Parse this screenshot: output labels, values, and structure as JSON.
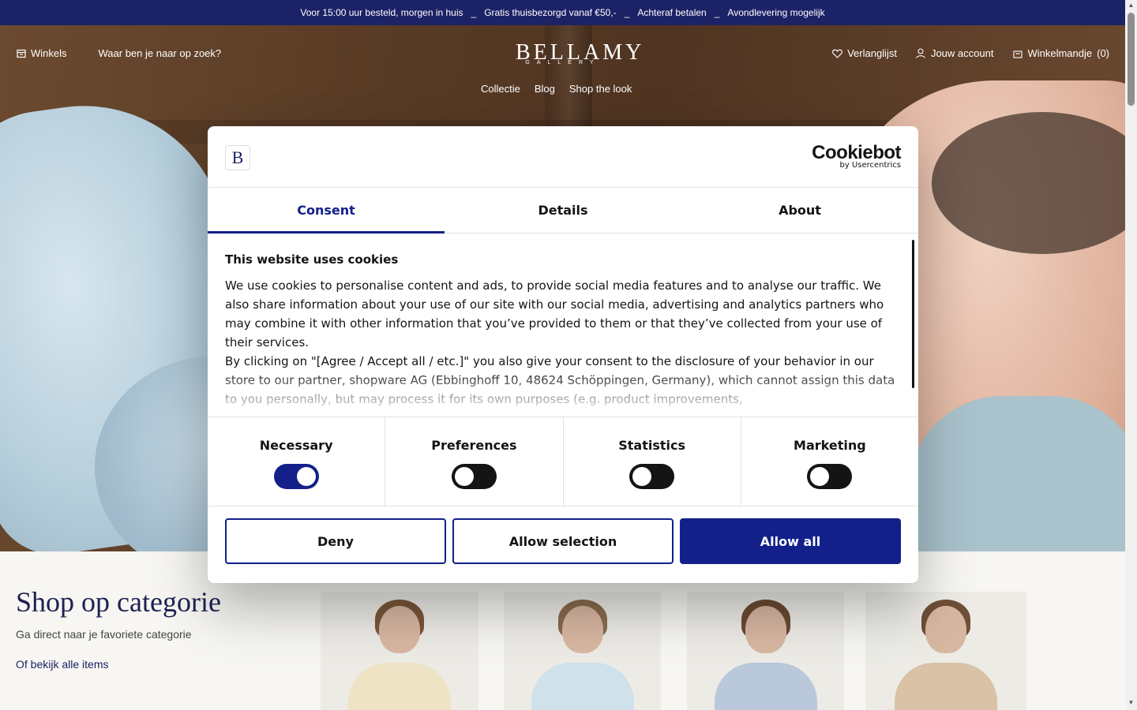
{
  "promo_bar": {
    "items": [
      "Voor 15:00 uur besteld, morgen in huis",
      "Gratis thuisbezorgd vanaf €50,-",
      "Achteraf betalen",
      "Avondlevering mogelijk"
    ],
    "separator": "_"
  },
  "header": {
    "stores_label": "Winkels",
    "search_placeholder": "Waar ben je naar op zoek?",
    "logo_text": "BELLAMY",
    "logo_subtext": "GALLERY",
    "wishlist_label": "Verlanglijst",
    "account_label": "Jouw account",
    "cart_label": "Winkelmandje",
    "cart_count": "(0)",
    "nav": [
      "Collectie",
      "Blog",
      "Shop the look"
    ]
  },
  "category_section": {
    "title": "Shop op categorie",
    "subtitle": "Ga direct naar je favoriete categorie",
    "link": "Of bekijk alle items"
  },
  "cookie_dialog": {
    "logo_letter": "B",
    "provider": "Cookiebot",
    "provider_sub": "by Usercentrics",
    "tabs": [
      "Consent",
      "Details",
      "About"
    ],
    "active_tab": "Consent",
    "heading": "This website uses cookies",
    "paragraph1": "We use cookies to personalise content and ads, to provide social media features and to analyse our traffic. We also share information about your use of our site with our social media, advertising and analytics partners who may combine it with other information that you’ve provided to them or that they’ve collected from your use of their services.",
    "paragraph2": "By clicking on \"[Agree / Accept all / etc.]\" you also give your consent to the disclosure of your behavior in our store to our partner, shopware AG (Ebbinghoff 10, 48624 Schöppingen, Germany), which cannot assign this data to you personally, but may process it for its own purposes (e.g. product improvements,",
    "toggles": [
      {
        "label": "Necessary",
        "on": true
      },
      {
        "label": "Preferences",
        "on": false
      },
      {
        "label": "Statistics",
        "on": false
      },
      {
        "label": "Marketing",
        "on": false
      }
    ],
    "buttons": {
      "deny": "Deny",
      "allow_selection": "Allow selection",
      "allow_all": "Allow all"
    }
  },
  "colors": {
    "brand_navy": "#1c2266",
    "consent_accent": "#13208a"
  }
}
